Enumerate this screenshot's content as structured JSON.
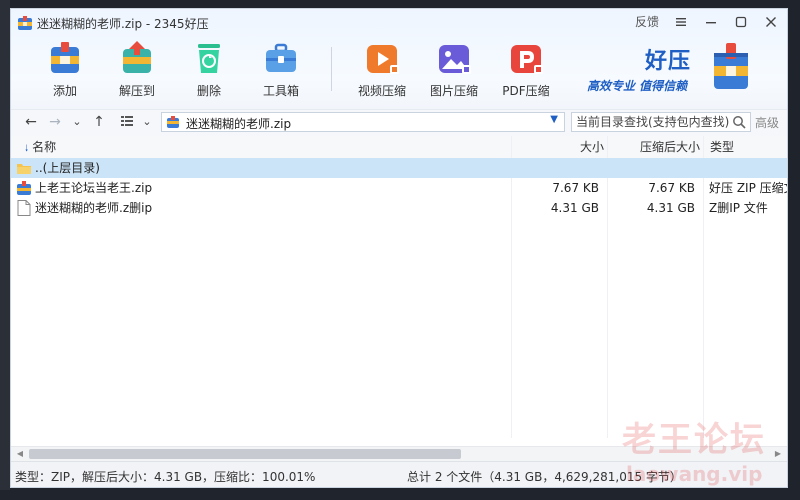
{
  "window": {
    "title": "迷迷糊糊的老师.zip - 2345好压",
    "feedback_label": "反馈"
  },
  "toolbar": {
    "buttons": [
      {
        "label": "添加",
        "icon": "add-archive-icon"
      },
      {
        "label": "解压到",
        "icon": "extract-icon"
      },
      {
        "label": "删除",
        "icon": "delete-recycle-icon"
      },
      {
        "label": "工具箱",
        "icon": "toolbox-icon"
      },
      {
        "label": "视频压缩",
        "icon": "video-compress-icon"
      },
      {
        "label": "图片压缩",
        "icon": "image-compress-icon"
      },
      {
        "label": "PDF压缩",
        "icon": "pdf-compress-icon"
      }
    ]
  },
  "brand": {
    "name": "好压",
    "slogan": "高效专业  值得信赖"
  },
  "nav": {
    "path": "迷迷糊糊的老师.zip",
    "search_placeholder": "当前目录查找(支持包内查找)",
    "advanced_label": "高级"
  },
  "list": {
    "columns": {
      "name": "名称",
      "size": "大小",
      "packed": "压缩后大小",
      "type": "类型"
    },
    "rows": [
      {
        "name": "..(上层目录)",
        "size": "",
        "packed": "",
        "type": "",
        "icon": "folder-icon",
        "selected": true
      },
      {
        "name": "上老王论坛当老王.zip",
        "size": "7.67 KB",
        "packed": "7.67 KB",
        "type": "好压 ZIP 压缩文件",
        "icon": "zip-archive-icon",
        "selected": false
      },
      {
        "name": "迷迷糊糊的老师.z删ip",
        "size": "4.31 GB",
        "packed": "4.31 GB",
        "type": "Z删IP 文件",
        "icon": "blank-file-icon",
        "selected": false
      }
    ]
  },
  "status": {
    "left": "类型：ZIP，解压后大小：4.31 GB，压缩比：100.01%",
    "right": "总计 2 个文件（4.31 GB，4,629,281,015 字节）"
  },
  "watermark": {
    "line1": "老王论坛",
    "line2": "laowang.vip"
  },
  "colors": {
    "accent": "#1f5fc4",
    "selection": "#cce4f7",
    "watermark": "#e13c3c"
  }
}
